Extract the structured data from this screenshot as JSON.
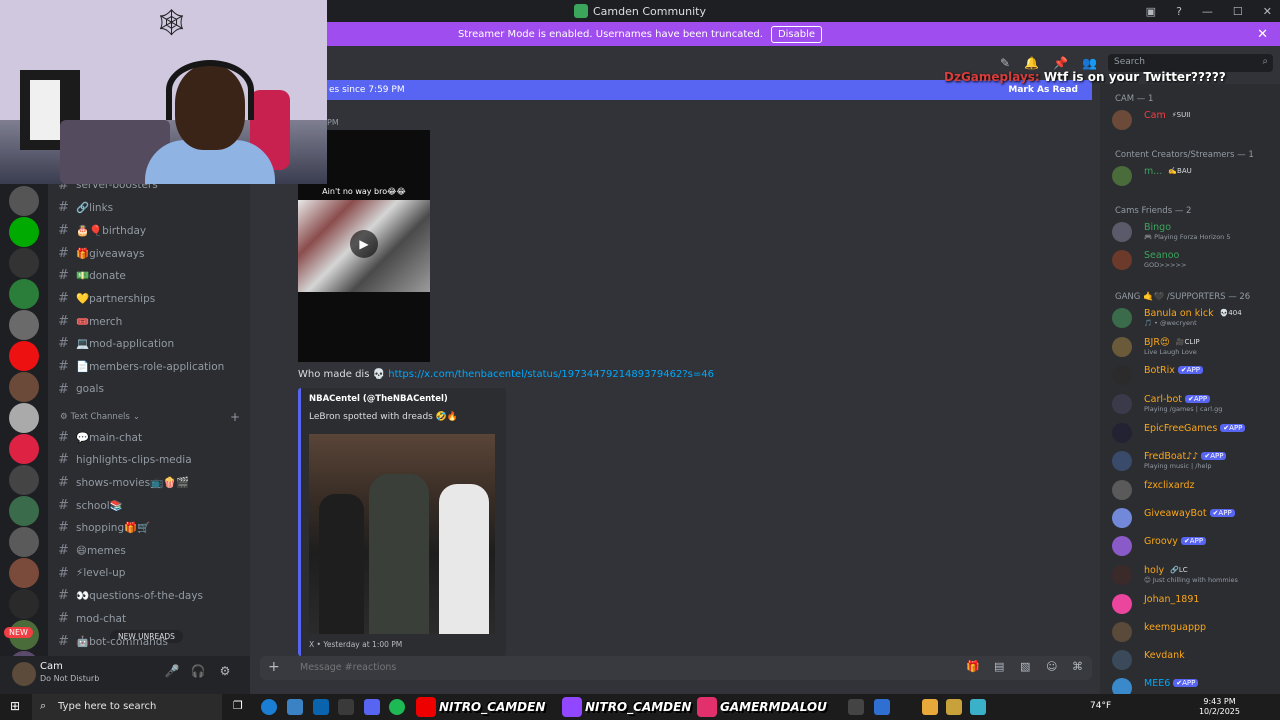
{
  "titlebar": {
    "title": "Camden Community"
  },
  "banner": {
    "text": "Streamer Mode is enabled. Usernames have been truncated.",
    "button": "Disable"
  },
  "search": {
    "placeholder": "Search"
  },
  "stream_overlay": {
    "user": "DzGameplays:",
    "text": "Wtf is on your Twitter?????"
  },
  "new_messages_bar": {
    "text": "es since 7:59 PM",
    "mark_read": "Mark As Read"
  },
  "channels": [
    {
      "name": "server-boosters"
    },
    {
      "name": "🔗links"
    },
    {
      "name": "🎂🎈birthday"
    },
    {
      "name": "🎁giveaways"
    },
    {
      "name": "💵donate"
    },
    {
      "name": "💛partnerships"
    },
    {
      "name": "🎟️merch"
    },
    {
      "name": "💻mod-application"
    },
    {
      "name": "📄members-role-application"
    },
    {
      "name": "goals"
    }
  ],
  "category": {
    "label": "Text Channels"
  },
  "channels2": [
    {
      "name": "💬main-chat"
    },
    {
      "name": "highlights-clips-media"
    },
    {
      "name": "shows-movies📺🍿🎬"
    },
    {
      "name": "school📚"
    },
    {
      "name": "shopping🎁🛒"
    },
    {
      "name": "😄memes"
    },
    {
      "name": "⚡level-up"
    },
    {
      "name": "👀questions-of-the-days"
    },
    {
      "name": "mod-chat"
    },
    {
      "name": "🤖bot-commands"
    }
  ],
  "new_unreads": "NEW UNREADS",
  "rail_new": "NEW",
  "user": {
    "name": "Cam",
    "status": "Do Not Disturb"
  },
  "chat": {
    "time_partial": "PM",
    "video_caption": "Ain't no way bro😂😂",
    "msg2_text": "Who made dis 💀",
    "msg2_link": "https://x.com/thenbacentel/status/1973447921489379462?s=46",
    "embed_author": "NBACentel (@TheNBACentel)",
    "embed_text": "LeBron spotted with dreads 🤣🔥",
    "embed_footer": "X • Yesterday at 1:00 PM",
    "composer_placeholder": "Message #reactions"
  },
  "members": {
    "groups": [
      {
        "label": "CAM — 1"
      },
      {
        "label": "Content Creators/Streamers — 1"
      },
      {
        "label": "Cams Friends — 2"
      },
      {
        "label": "GANG 🤙🖤 /SUPPORTERS — 26"
      }
    ],
    "list": [
      {
        "name": "Cam",
        "tag": "⚡SUII",
        "sub": "",
        "color": "#f23f43",
        "av": "#6b4a3a"
      },
      {
        "name": "m...",
        "tag": "✍️BAU",
        "sub": "",
        "color": "#3ba55c",
        "av": "#4a6b3a"
      },
      {
        "name": "Bingo",
        "tag": "",
        "sub": "🎮 Playing Forza Horizon 5",
        "color": "#3ba55c",
        "av": "#5a5a6b"
      },
      {
        "name": "Seanoo",
        "tag": "",
        "sub": "GOD>>>>>",
        "color": "#3ba55c",
        "av": "#6b3a2a"
      },
      {
        "name": "Banula on kick",
        "tag": "💀404",
        "sub": "🎵 • @wecryent",
        "color": "#faa61a",
        "av": "#3a6b4a"
      },
      {
        "name": "BJR😍",
        "tag": "🎥CLIP",
        "sub": "Live Laugh Love",
        "color": "#faa61a",
        "av": "#6b5a3a"
      },
      {
        "name": "BotRix",
        "tag": "✔APP",
        "sub": "",
        "color": "#faa61a",
        "av": "#2b2b2b"
      },
      {
        "name": "Carl-bot",
        "tag": "✔APP",
        "sub": "Playing /games | carl.gg",
        "color": "#faa61a",
        "av": "#3a3a4a"
      },
      {
        "name": "EpicFreeGames",
        "tag": "✔APP",
        "sub": "",
        "color": "#faa61a",
        "av": "#222233"
      },
      {
        "name": "FredBoat♪♪",
        "tag": "✔APP",
        "sub": "Playing music | /help",
        "color": "#faa61a",
        "av": "#3a4a6b"
      },
      {
        "name": "fzxclixardz",
        "tag": "",
        "sub": "",
        "color": "#faa61a",
        "av": "#5a5a5a"
      },
      {
        "name": "GiveawayBot",
        "tag": "✔APP",
        "sub": "",
        "color": "#faa61a",
        "av": "#7289da"
      },
      {
        "name": "Groovy",
        "tag": "✔APP",
        "sub": "",
        "color": "#faa61a",
        "av": "#8a5ac8"
      },
      {
        "name": "holy",
        "tag": "🔗LC",
        "sub": "😊 Just chilling with hommies",
        "color": "#faa61a",
        "av": "#3a2a2a"
      },
      {
        "name": "Johan_1891",
        "tag": "",
        "sub": "",
        "color": "#faa61a",
        "av": "#eb459e"
      },
      {
        "name": "keemguappp",
        "tag": "",
        "sub": "",
        "color": "#faa61a",
        "av": "#5a4a3a"
      },
      {
        "name": "Kevdank",
        "tag": "",
        "sub": "",
        "color": "#faa61a",
        "av": "#3a4a5a"
      },
      {
        "name": "MEE6",
        "tag": "✔APP",
        "sub": "",
        "color": "#00a8fc",
        "av": "#3a8acb"
      }
    ]
  },
  "taskbar": {
    "search": "Type here to search",
    "overlay1": "NITRO_CAMDEN",
    "overlay2": "NITRO_CAMDEN",
    "overlay3": "GAMERMDALOU",
    "temp": "74°F",
    "time": "9:43 PM",
    "date": "10/2/2025"
  }
}
